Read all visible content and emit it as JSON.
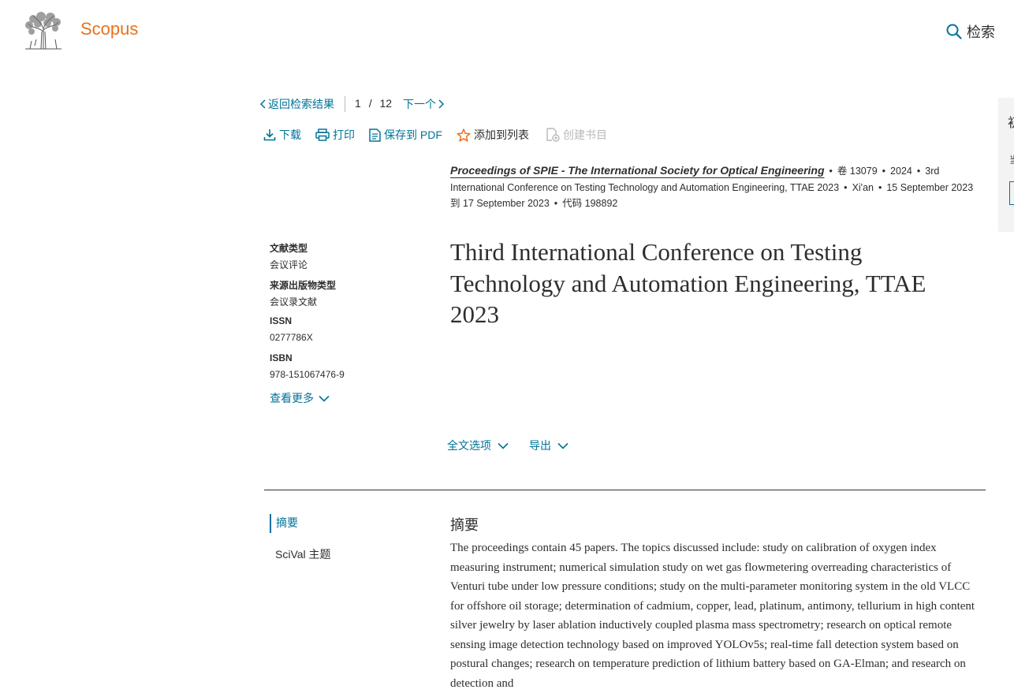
{
  "header": {
    "brand": "Scopus",
    "search_label": "检索"
  },
  "navigation": {
    "back_label": "返回检索结果",
    "current": "1",
    "separator": "/",
    "total": "12",
    "next_label": "下一个"
  },
  "toolbar": {
    "download": "下载",
    "print": "打印",
    "save_pdf": "保存到 PDF",
    "add_to_list": "添加到列表",
    "create_bib": "创建书目"
  },
  "source": {
    "title": "Proceedings of SPIE - The International Society for Optical Engineering",
    "volume": "卷 13079",
    "year": "2024",
    "conference": "3rd International Conference on Testing Technology and Automation Engineering, TTAE 2023",
    "location": "Xi'an",
    "dates": "15 September 2023到 17 September 2023",
    "code": "代码 198892"
  },
  "metadata": [
    {
      "label": "文献类型",
      "value": "会议评论"
    },
    {
      "label": "来源出版物类型",
      "value": "会议录文献"
    },
    {
      "label": "ISSN",
      "value": "0277786X"
    },
    {
      "label": "ISBN",
      "value": "978-151067476-9"
    }
  ],
  "see_more": "查看更多",
  "title": "Third International Conference on Testing Technology and Automation Engineering, TTAE 2023",
  "actions": {
    "fulltext": "全文选项",
    "export": "导出"
  },
  "section_nav": {
    "abstract": "摘要",
    "scival": "SciVal 主题"
  },
  "abstract": {
    "heading": "摘要",
    "text": "The proceedings contain 45 papers. The topics discussed include: study on calibration of oxygen index measuring instrument; numerical simulation study on wet gas flowmetering overreading characteristics of Venturi tube under low pressure conditions; study on the multi-parameter monitoring system in the old VLCC for offshore oil storage; determination of cadmium, copper, lead, platinum, antimony, tellurium in high content silver jewelry by laser ablation inductively coupled plasma mass spectrometry; research on optical remote sensing image detection technology based on improved YOLOv5s; real-time fall detection system based on postural changes; research on temperature prediction of lithium battery based on GA-Elman; and research on detection and"
  },
  "side_panel": {
    "char": "初",
    "mark": "当"
  },
  "colors": {
    "brand": "#e9711c",
    "link": "#007398",
    "text": "#2e2e2e",
    "disabled": "#b9b9b9"
  }
}
